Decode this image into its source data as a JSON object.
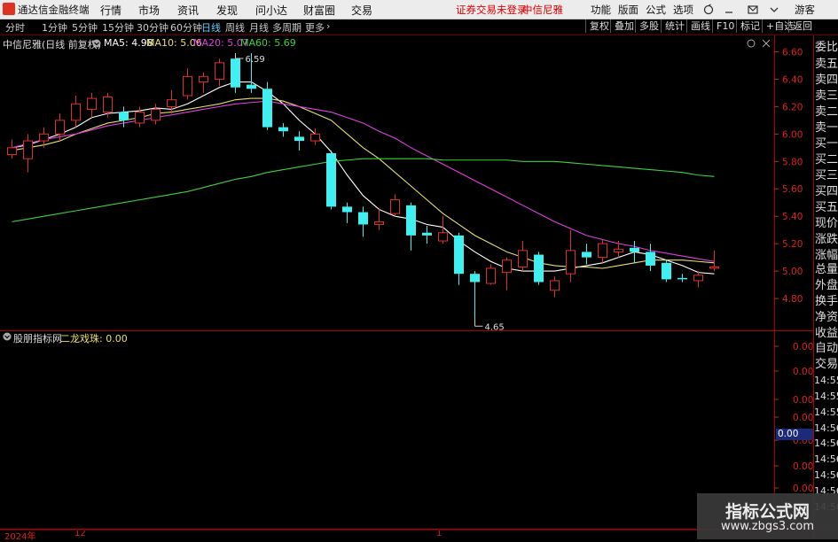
{
  "titlebar": {
    "app_name": "通达信金融终端",
    "menu": [
      "行情",
      "市场",
      "资讯",
      "发现",
      "问小达",
      "财富圈",
      "交易"
    ],
    "alert": "证券交易未登录",
    "stock": "中信尼雅",
    "right": [
      "功能",
      "版面",
      "公式",
      "选项"
    ],
    "user": "游客"
  },
  "toolbar": {
    "periods": [
      "分时",
      "1分钟",
      "5分钟",
      "15分钟",
      "30分钟",
      "60分钟",
      "日线",
      "周线",
      "月线",
      "多周期",
      "更多"
    ],
    "active_period": "日线",
    "right_buttons": [
      "复权",
      "叠加",
      "多股",
      "统计",
      "画线",
      "F10",
      "标记",
      "+自选",
      "返回"
    ]
  },
  "chart_legend": {
    "title": "中信尼雅(日线 前复权)",
    "ma": [
      {
        "label": "MA5: 4.98",
        "color": "#ffffff"
      },
      {
        "label": "MA10: 5.06",
        "color": "#e8e070"
      },
      {
        "label": "MA20: 5.07",
        "color": "#e040e0"
      },
      {
        "label": "MA60: 5.69",
        "color": "#40d040"
      }
    ]
  },
  "indicator": {
    "name": "股朋指标网",
    "label": "二龙戏珠: 0.00"
  },
  "right_panel": {
    "labels": [
      "委比",
      "卖五",
      "卖四",
      "卖三",
      "卖二",
      "卖一",
      "买一",
      "买二",
      "买三",
      "买四",
      "买五",
      "现价",
      "涨跌",
      "涨幅",
      "总量",
      "外盘",
      "换手",
      "净资",
      "收益",
      "自动",
      "交易"
    ],
    "times": [
      "14:55",
      "14:55",
      "14:55",
      "14:56",
      "14:56",
      "14:56",
      "14:56",
      "14:56",
      "14:56"
    ],
    "zero": "0.00"
  },
  "x_axis": {
    "year": "2024年",
    "m1": "12",
    "m2": "1"
  },
  "watermark": {
    "line1": "指标公式网",
    "line2": "www.zbgs3.com"
  },
  "colors": {
    "up": "#e03030",
    "down": "#40f0f0",
    "ma5": "#ffffff",
    "ma10": "#e8e070",
    "ma20": "#e040e0",
    "ma60": "#40d040"
  },
  "chart_data": {
    "type": "candlestick",
    "title": "中信尼雅(日线 前复权)",
    "ylim": [
      4.6,
      6.7
    ],
    "yticks": [
      4.8,
      5.0,
      5.2,
      5.4,
      5.6,
      5.8,
      6.0,
      6.2,
      6.4,
      6.6
    ],
    "indicator_ticks": [
      "0.00",
      "0.00",
      "0.00",
      "0.00",
      "0.00",
      "0.00",
      "0.00"
    ],
    "indicator_ticks_values": [
      0.0,
      0.0,
      0.0,
      0.0,
      0.0,
      0.0,
      0.0
    ],
    "annotations": [
      {
        "text": "6.59",
        "value": 6.59
      },
      {
        "text": "4.65",
        "value": 4.65
      }
    ],
    "candles": [
      {
        "o": 5.85,
        "c": 5.9,
        "h": 5.96,
        "l": 5.82
      },
      {
        "o": 5.82,
        "c": 5.95,
        "h": 6.0,
        "l": 5.72
      },
      {
        "o": 5.95,
        "c": 6.0,
        "h": 6.05,
        "l": 5.9
      },
      {
        "o": 6.0,
        "c": 6.1,
        "h": 6.15,
        "l": 5.95
      },
      {
        "o": 6.1,
        "c": 6.22,
        "h": 6.28,
        "l": 6.05
      },
      {
        "o": 6.18,
        "c": 6.26,
        "h": 6.3,
        "l": 6.12
      },
      {
        "o": 6.16,
        "c": 6.27,
        "h": 6.3,
        "l": 6.12
      },
      {
        "o": 6.16,
        "c": 6.1,
        "h": 6.2,
        "l": 6.05
      },
      {
        "o": 6.08,
        "c": 6.16,
        "h": 6.2,
        "l": 6.05
      },
      {
        "o": 6.1,
        "c": 6.18,
        "h": 6.22,
        "l": 6.07
      },
      {
        "o": 6.2,
        "c": 6.25,
        "h": 6.32,
        "l": 6.15
      },
      {
        "o": 6.28,
        "c": 6.42,
        "h": 6.48,
        "l": 6.25
      },
      {
        "o": 6.38,
        "c": 6.42,
        "h": 6.45,
        "l": 6.3
      },
      {
        "o": 6.4,
        "c": 6.52,
        "h": 6.55,
        "l": 6.35
      },
      {
        "o": 6.55,
        "c": 6.34,
        "h": 6.59,
        "l": 6.3
      },
      {
        "o": 6.36,
        "c": 6.33,
        "h": 6.59,
        "l": 6.3
      },
      {
        "o": 6.33,
        "c": 6.05,
        "h": 6.38,
        "l": 6.03
      },
      {
        "o": 6.05,
        "c": 6.02,
        "h": 6.08,
        "l": 5.98
      },
      {
        "o": 5.98,
        "c": 5.95,
        "h": 6.02,
        "l": 5.88
      },
      {
        "o": 5.95,
        "c": 6.0,
        "h": 6.04,
        "l": 5.92
      },
      {
        "o": 5.86,
        "c": 5.47,
        "h": 5.88,
        "l": 5.45
      },
      {
        "o": 5.47,
        "c": 5.43,
        "h": 5.5,
        "l": 5.35
      },
      {
        "o": 5.43,
        "c": 5.34,
        "h": 5.47,
        "l": 5.25
      },
      {
        "o": 5.34,
        "c": 5.36,
        "h": 5.46,
        "l": 5.3
      },
      {
        "o": 5.42,
        "c": 5.52,
        "h": 5.56,
        "l": 5.4
      },
      {
        "o": 5.48,
        "c": 5.26,
        "h": 5.5,
        "l": 5.15
      },
      {
        "o": 5.28,
        "c": 5.26,
        "h": 5.33,
        "l": 5.2
      },
      {
        "o": 5.22,
        "c": 5.28,
        "h": 5.4,
        "l": 5.2
      },
      {
        "o": 5.26,
        "c": 4.98,
        "h": 5.28,
        "l": 4.9
      },
      {
        "o": 4.98,
        "c": 4.92,
        "h": 5.0,
        "l": 4.65
      },
      {
        "o": 4.91,
        "c": 5.02,
        "h": 5.05,
        "l": 4.9
      },
      {
        "o": 4.99,
        "c": 5.08,
        "h": 5.1,
        "l": 4.86
      },
      {
        "o": 5.03,
        "c": 5.15,
        "h": 5.22,
        "l": 5.0
      },
      {
        "o": 5.12,
        "c": 4.92,
        "h": 5.14,
        "l": 4.9
      },
      {
        "o": 4.86,
        "c": 4.93,
        "h": 4.96,
        "l": 4.81
      },
      {
        "o": 4.98,
        "c": 5.15,
        "h": 5.3,
        "l": 4.92
      },
      {
        "o": 5.14,
        "c": 5.1,
        "h": 5.2,
        "l": 5.05
      },
      {
        "o": 5.1,
        "c": 5.2,
        "h": 5.23,
        "l": 5.06
      },
      {
        "o": 5.14,
        "c": 5.16,
        "h": 5.22,
        "l": 5.1
      },
      {
        "o": 5.17,
        "c": 5.14,
        "h": 5.22,
        "l": 5.06
      },
      {
        "o": 5.14,
        "c": 5.04,
        "h": 5.2,
        "l": 5.0
      },
      {
        "o": 5.06,
        "c": 4.94,
        "h": 5.08,
        "l": 4.92
      },
      {
        "o": 4.95,
        "c": 4.94,
        "h": 4.98,
        "l": 4.92
      },
      {
        "o": 4.93,
        "c": 4.97,
        "h": 5.0,
        "l": 4.88
      },
      {
        "o": 5.02,
        "c": 5.03,
        "h": 5.15,
        "l": 5.0
      }
    ],
    "series": [
      {
        "name": "MA5",
        "values": [
          5.9,
          5.92,
          5.96,
          6.0,
          6.05,
          6.12,
          6.15,
          6.16,
          6.17,
          6.19,
          6.18,
          6.22,
          6.28,
          6.34,
          6.38,
          6.38,
          6.31,
          6.22,
          6.1,
          6.0,
          5.87,
          5.7,
          5.55,
          5.45,
          5.4,
          5.38,
          5.34,
          5.32,
          5.22,
          5.14,
          5.07,
          5.02,
          5.0,
          5.0,
          5.0,
          5.02,
          5.04,
          5.06,
          5.1,
          5.14,
          5.12,
          5.08,
          5.04,
          4.99,
          4.98
        ]
      },
      {
        "name": "MA10",
        "values": [
          5.88,
          5.9,
          5.92,
          5.95,
          6.0,
          6.04,
          6.08,
          6.1,
          6.12,
          6.15,
          6.16,
          6.18,
          6.2,
          6.22,
          6.25,
          6.26,
          6.26,
          6.24,
          6.2,
          6.15,
          6.1,
          6.0,
          5.9,
          5.82,
          5.72,
          5.62,
          5.52,
          5.42,
          5.34,
          5.26,
          5.2,
          5.14,
          5.1,
          5.06,
          5.04,
          5.03,
          5.03,
          5.02,
          5.04,
          5.06,
          5.08,
          5.08,
          5.08,
          5.07,
          5.06
        ]
      },
      {
        "name": "MA20",
        "values": [
          5.9,
          5.93,
          5.96,
          5.98,
          6.0,
          6.03,
          6.06,
          6.08,
          6.1,
          6.12,
          6.14,
          6.16,
          6.18,
          6.2,
          6.22,
          6.23,
          6.24,
          6.22,
          6.2,
          6.18,
          6.16,
          6.12,
          6.08,
          6.02,
          5.97,
          5.9,
          5.84,
          5.78,
          5.72,
          5.66,
          5.6,
          5.54,
          5.48,
          5.42,
          5.36,
          5.31,
          5.26,
          5.23,
          5.2,
          5.18,
          5.15,
          5.13,
          5.11,
          5.09,
          5.07
        ]
      },
      {
        "name": "MA60",
        "values": [
          5.36,
          5.38,
          5.4,
          5.42,
          5.44,
          5.46,
          5.48,
          5.5,
          5.52,
          5.54,
          5.56,
          5.58,
          5.61,
          5.64,
          5.67,
          5.69,
          5.72,
          5.74,
          5.76,
          5.78,
          5.8,
          5.81,
          5.82,
          5.82,
          5.82,
          5.82,
          5.82,
          5.81,
          5.81,
          5.81,
          5.81,
          5.81,
          5.8,
          5.8,
          5.8,
          5.79,
          5.78,
          5.77,
          5.76,
          5.75,
          5.74,
          5.73,
          5.72,
          5.7,
          5.69
        ]
      }
    ]
  }
}
